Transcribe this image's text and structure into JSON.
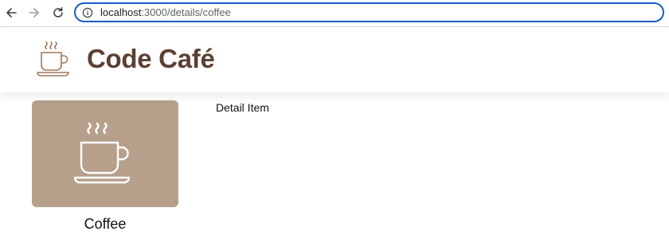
{
  "browser": {
    "url_host": "localhost",
    "url_path": ":3000/details/coffee",
    "icons": [
      "back-arrow-icon",
      "forward-arrow-icon",
      "reload-icon",
      "info-icon"
    ]
  },
  "header": {
    "brand_name": "Code Café",
    "logo_icon": "coffee-cup-logo-icon",
    "brand_color": "#5b4033"
  },
  "main": {
    "item_card": {
      "label": "Coffee",
      "icon": "coffee-cup-icon",
      "background_color": "#b6a08b"
    },
    "detail_text": "Detail Item"
  }
}
